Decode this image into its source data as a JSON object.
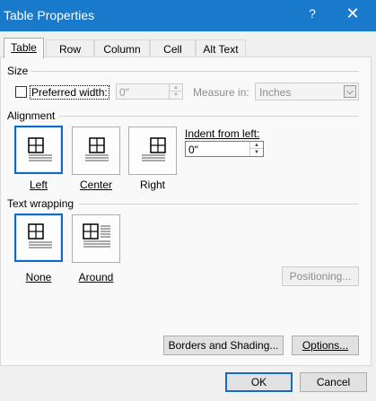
{
  "window": {
    "title": "Table Properties",
    "help_glyph": "?",
    "close_glyph": "✕"
  },
  "tabs": [
    {
      "label": "Table",
      "active": true
    },
    {
      "label": "Row",
      "active": false
    },
    {
      "label": "Column",
      "active": false
    },
    {
      "label": "Cell",
      "active": false
    },
    {
      "label": "Alt Text",
      "active": false
    }
  ],
  "size": {
    "group_label": "Size",
    "preferred_width_label": "Preferred width:",
    "preferred_width_checked": false,
    "width_value": "0\"",
    "measure_in_label": "Measure in:",
    "measure_in_value": "Inches"
  },
  "alignment": {
    "group_label": "Alignment",
    "options": [
      "Left",
      "Center",
      "Right"
    ],
    "selected": "Left",
    "indent_label": "Indent from left:",
    "indent_value": "0\""
  },
  "text_wrapping": {
    "group_label": "Text wrapping",
    "options": [
      "None",
      "Around"
    ],
    "selected": "None",
    "positioning_label": "Positioning..."
  },
  "buttons": {
    "borders_shading": "Borders and Shading...",
    "options": "Options...",
    "ok": "OK",
    "cancel": "Cancel"
  },
  "colors": {
    "titlebar": "#1979ca",
    "accent": "#0f6cc5"
  }
}
